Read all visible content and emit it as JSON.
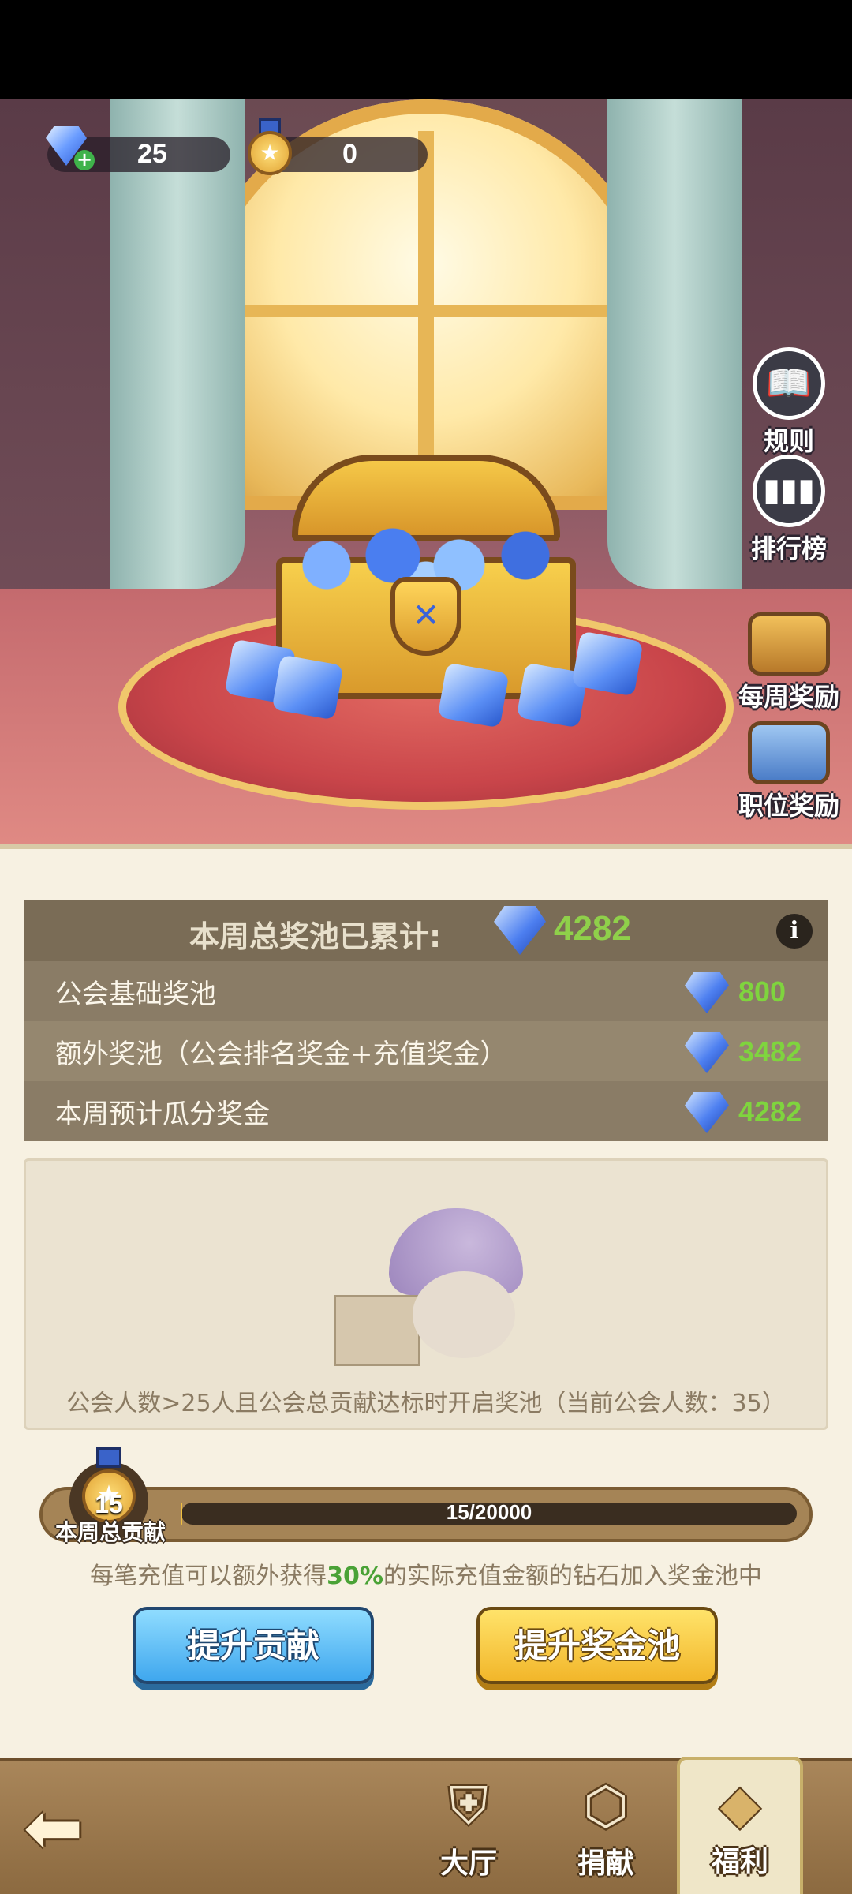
{
  "currencies": {
    "diamonds": "25",
    "medals": "0"
  },
  "side_menu": [
    {
      "label": "规则",
      "icon": "rules-book-icon"
    },
    {
      "label": "排行榜",
      "icon": "leaderboard-icon"
    },
    {
      "label": "每周奖励",
      "icon": "weekly-reward-chest-icon"
    },
    {
      "label": "职位奖励",
      "icon": "position-reward-chest-icon"
    }
  ],
  "pool": {
    "title": "本周总奖池已累计:",
    "total": "4282",
    "rows": [
      {
        "label": "公会基础奖池",
        "value": "800"
      },
      {
        "label": "额外奖池（公会排名奖金+充值奖金）",
        "value": "3482"
      },
      {
        "label": "本周预计瓜分奖金",
        "value": "4282"
      }
    ]
  },
  "notice": "公会人数>25人且公会总贡献达标时开启奖池（当前公会人数：35）",
  "contribution": {
    "level": "15",
    "label": "本周总贡献",
    "progress_text": "15/20000",
    "progress_fraction": 0.00075
  },
  "hint": {
    "before": "每笔充值可以额外获得",
    "pct": "30%",
    "after": "的实际充值金额的钻石加入奖金池中"
  },
  "buttons": {
    "contribute": "提升贡献",
    "pool": "提升奖金池"
  },
  "nav": {
    "items": [
      {
        "label": "大厅",
        "icon": "hall-icon"
      },
      {
        "label": "捐献",
        "icon": "donate-icon"
      },
      {
        "label": "福利",
        "icon": "welfare-gem-icon",
        "active": true
      }
    ]
  },
  "colors": {
    "accent_green": "#7fd43e",
    "panel_bg": "#f7f1e2",
    "pool_bg": "#8a7c66"
  }
}
